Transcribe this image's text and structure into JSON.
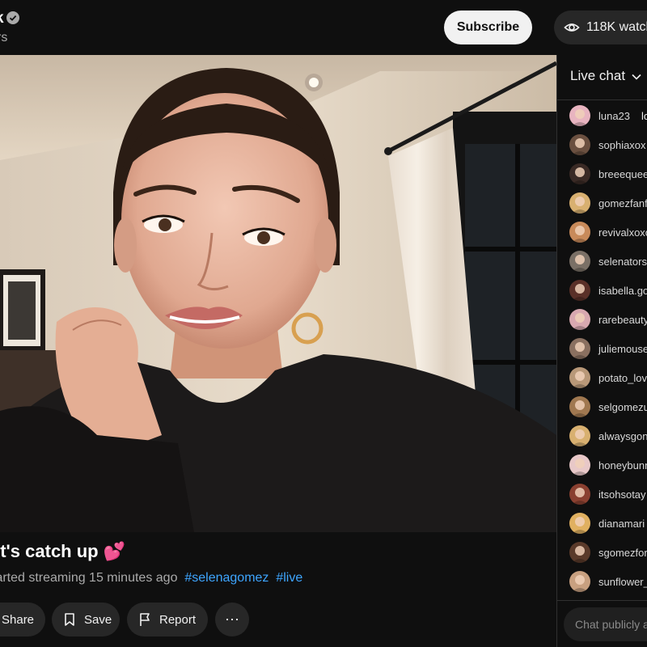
{
  "channel": {
    "name_fragment": "k",
    "subscribers_fragment": "rs"
  },
  "header": {
    "subscribe_label": "Subscribe",
    "watching": "118K watch"
  },
  "video": {
    "title": "et's catch up 💕",
    "started": "tarted streaming 15 minutes ago",
    "hashtags": [
      "#selenagomez",
      "#live"
    ]
  },
  "actions": {
    "share": "Share",
    "save": "Save",
    "report": "Report",
    "more": "⋯"
  },
  "chat": {
    "title": "Live chat",
    "input_placeholder": "Chat publicly a",
    "messages": [
      {
        "user": "luna23",
        "text": "lo",
        "avatar_color": "#e8b4c0"
      },
      {
        "user": "sophiaxox",
        "text": "",
        "avatar_color": "#6b5040"
      },
      {
        "user": "breeequee",
        "text": "",
        "avatar_color": "#3a2a25"
      },
      {
        "user": "gomezfanf",
        "text": "",
        "avatar_color": "#d8b070"
      },
      {
        "user": "revivalxoxo",
        "text": "",
        "avatar_color": "#c88a5a"
      },
      {
        "user": "selenators",
        "text": "",
        "avatar_color": "#7a7066"
      },
      {
        "user": "isabella.go",
        "text": "",
        "avatar_color": "#5a3028"
      },
      {
        "user": "rarebeauty",
        "text": "",
        "avatar_color": "#d8a8b0"
      },
      {
        "user": "juliemouse",
        "text": "",
        "avatar_color": "#8a7060"
      },
      {
        "user": "potato_lov",
        "text": "",
        "avatar_color": "#b89878"
      },
      {
        "user": "selgomezu",
        "text": "",
        "avatar_color": "#a07850"
      },
      {
        "user": "alwaysgon",
        "text": "",
        "avatar_color": "#d8b070"
      },
      {
        "user": "honeybunn",
        "text": "",
        "avatar_color": "#e8c8c8"
      },
      {
        "user": "itsohsotay",
        "text": "",
        "avatar_color": "#8a4030"
      },
      {
        "user": "dianamari",
        "text": "",
        "avatar_color": "#e0b060"
      },
      {
        "user": "sgomezfor",
        "text": "",
        "avatar_color": "#5a3a2a"
      },
      {
        "user": "sunflower_",
        "text": "",
        "avatar_color": "#c8a080"
      }
    ]
  },
  "colors": {
    "background": "#0f0f0f",
    "pill": "#272727",
    "hashtag": "#3ea6ff",
    "subscribe_bg": "#f1f1f1"
  }
}
